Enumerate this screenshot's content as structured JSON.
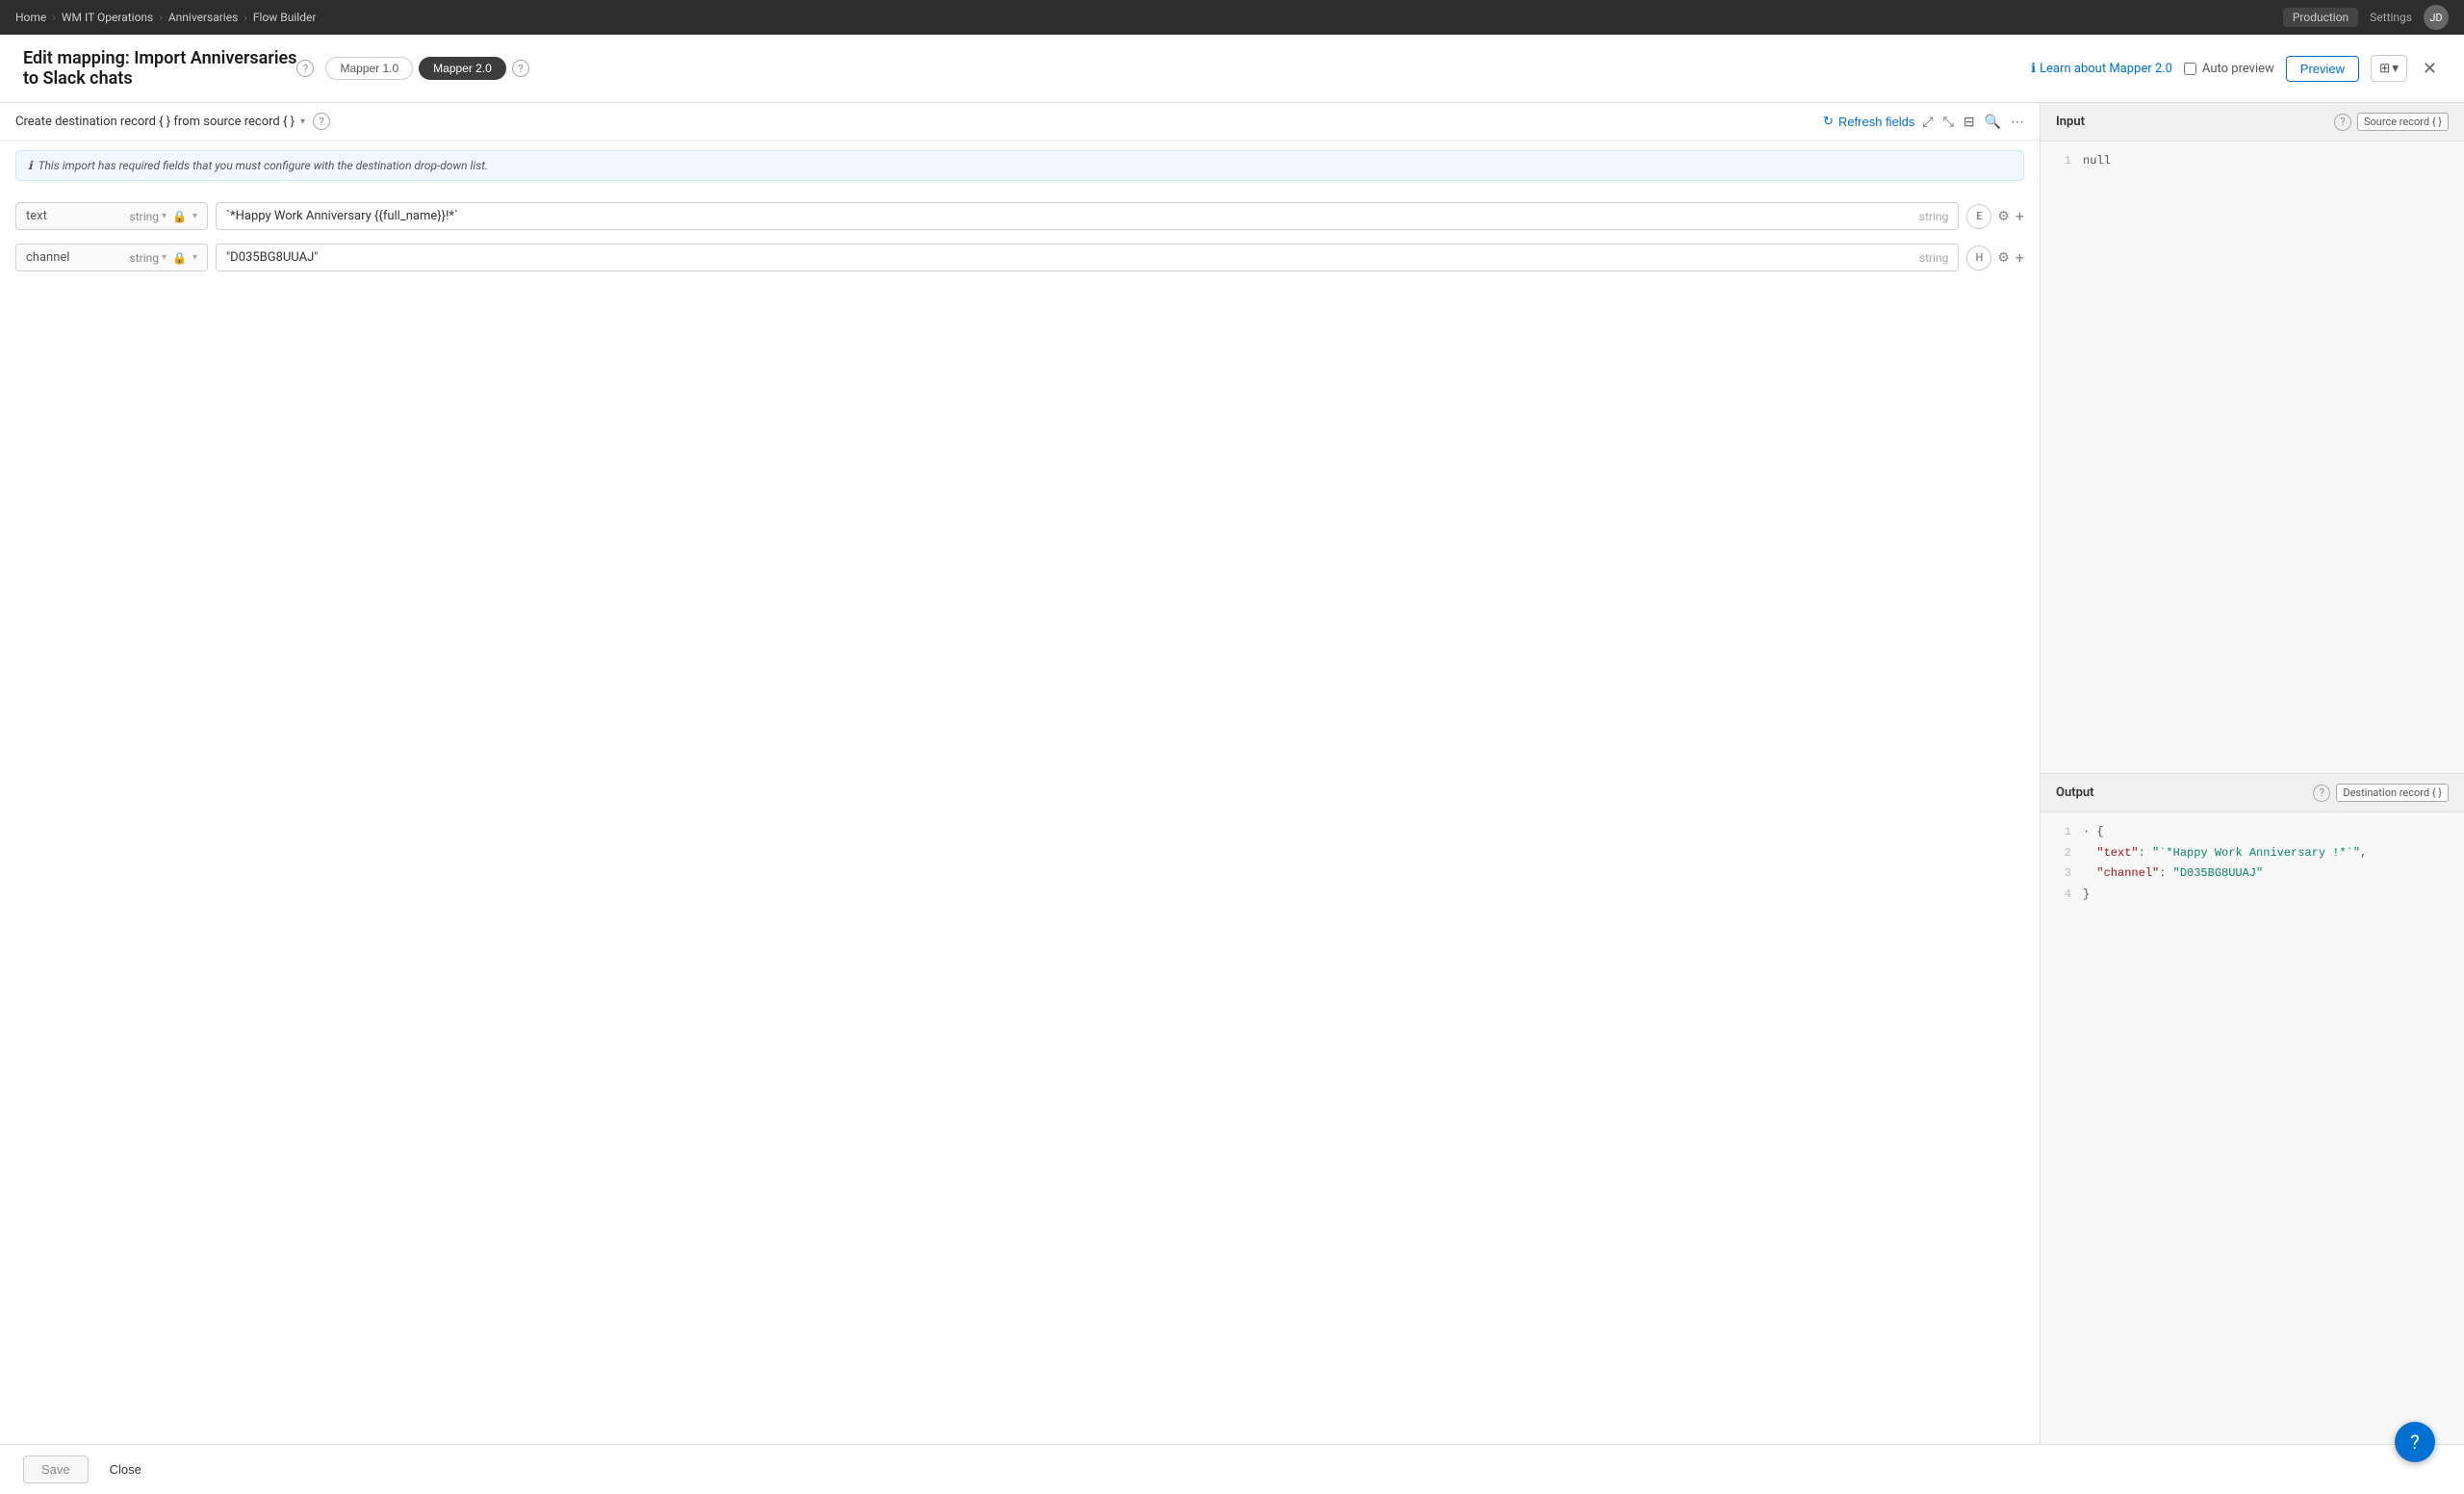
{
  "topbar": {
    "breadcrumb": [
      "Home",
      "WM IT Operations",
      "Anniversaries",
      "Flow Builder"
    ],
    "env_label": "Production",
    "settings_label": "Settings",
    "avatar_initials": "JD"
  },
  "header": {
    "title_line1": "Edit mapping: Import Anniversaries",
    "title_line2": "to Slack chats",
    "mapper1_label": "Mapper 1.0",
    "mapper2_label": "Mapper 2.0",
    "learn_label": "Learn about Mapper 2.0",
    "auto_preview_label": "Auto preview",
    "preview_label": "Preview"
  },
  "mapping": {
    "source_text": "Create destination record { } from source record { }",
    "refresh_label": "Refresh fields",
    "info_text": "This import has required fields that you must configure with the destination drop-down list.",
    "rows": [
      {
        "field": "text",
        "field_type": "string",
        "value": "`*Happy Work Anniversary {{full_name}}!*`",
        "value_type": "string",
        "action_label": "E"
      },
      {
        "field": "channel",
        "field_type": "string",
        "value": "\"D035BG8UUAJ\"",
        "value_type": "string",
        "action_label": "H"
      }
    ]
  },
  "right_panel": {
    "input_title": "Input",
    "input_badge": "Source record { }",
    "output_title": "Output",
    "output_badge": "Destination record { }",
    "input_lines": [
      {
        "num": "1",
        "content": "null"
      }
    ],
    "output_lines": [
      {
        "num": "1",
        "content": "{",
        "type": "punctuation"
      },
      {
        "num": "2",
        "content": "  \"text\": \"`*Happy Work Anniversary !*`\",",
        "type": "key-val"
      },
      {
        "num": "3",
        "content": "  \"channel\": \"D035BG8UUAJ\"",
        "type": "key-val"
      },
      {
        "num": "4",
        "content": "}",
        "type": "punctuation"
      }
    ]
  },
  "footer": {
    "save_label": "Save",
    "close_label": "Close"
  },
  "help_icon": "?"
}
